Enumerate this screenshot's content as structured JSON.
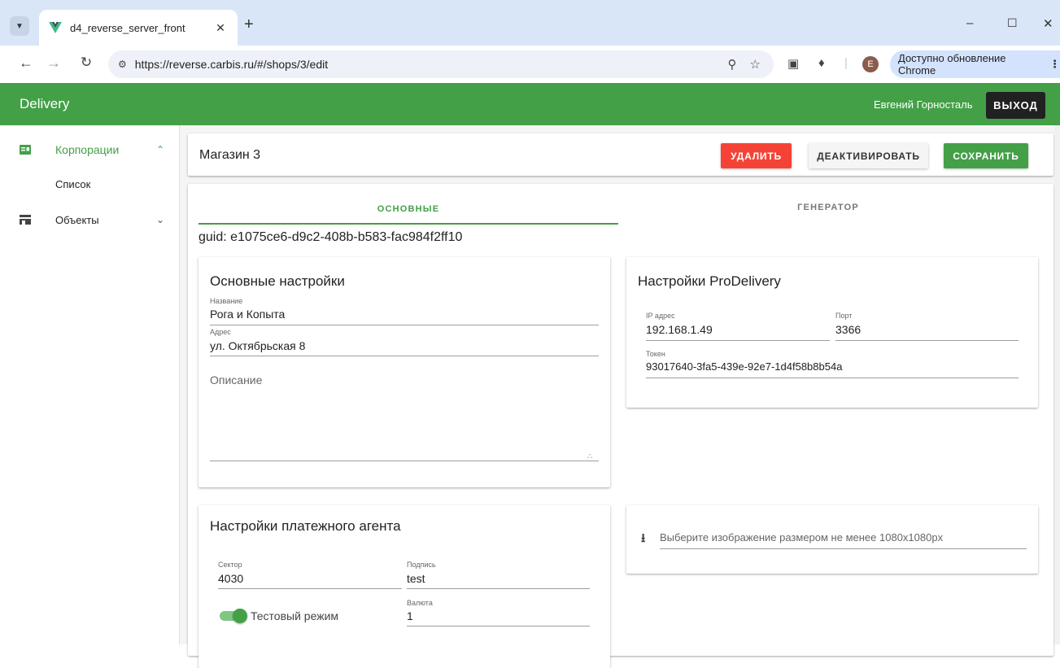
{
  "browser": {
    "tab_title": "d4_reverse_server_front",
    "url": "https://reverse.carbis.ru/#/shops/3/edit",
    "update_label": "Доступно обновление Chrome",
    "profile_initial": "E"
  },
  "header": {
    "title": "Delivery",
    "user_name": "Евгений Горносталь",
    "logout_label": "ВЫХОД",
    "accent_color": "#43a047"
  },
  "sidebar": {
    "items": [
      {
        "label": "Корпорации",
        "icon": "business-card-icon",
        "expanded": true
      },
      {
        "label": "Список"
      },
      {
        "label": "Объекты",
        "icon": "store-icon",
        "expanded": false
      }
    ]
  },
  "toolbar": {
    "title": "Магазин 3",
    "delete_label": "УДАЛИТЬ",
    "deactivate_label": "ДЕАКТИВИРОВАТЬ",
    "save_label": "СОХРАНИТЬ"
  },
  "tabs": {
    "main_label": "ОСНОВНЫЕ",
    "generator_label": "ГЕНЕРАТОР",
    "active": "main"
  },
  "guid": "guid: e1075ce6-d9c2-408b-b583-fac984f2ff10",
  "basic_settings": {
    "title": "Основные настройки",
    "name_label": "Название",
    "name_value": "Рога и Копыта",
    "address_label": "Адрес",
    "address_value": "ул. Октябрьская 8",
    "description_placeholder": "Описание"
  },
  "prodelivery": {
    "title": "Настройки ProDelivery",
    "ip_label": "IP адрес",
    "ip_value": "192.168.1.49",
    "port_label": "Порт",
    "port_value": "3366",
    "token_label": "Токен",
    "token_value": "93017640-3fa5-439e-92e7-1d4f58b8b54a"
  },
  "payment": {
    "title": "Настройки платежного агента",
    "sector_label": "Сектор",
    "sector_value": "4030",
    "signature_label": "Подпись",
    "signature_value": "test",
    "currency_label": "Валюта",
    "currency_value": "1",
    "test_mode_label": "Тестовый режим",
    "test_mode_on": true
  },
  "image_upload": {
    "placeholder": "Выберите изображение размером не менее 1080x1080px"
  }
}
